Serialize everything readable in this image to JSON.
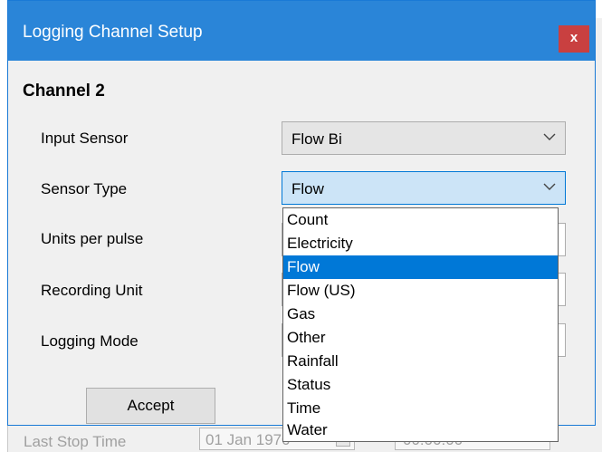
{
  "dialog": {
    "title": "Logging Channel Setup",
    "close_label": "x",
    "channel_title": "Channel 2",
    "accept_label": "Accept",
    "fields": {
      "input_sensor": {
        "label": "Input Sensor",
        "value": "Flow Bi"
      },
      "sensor_type": {
        "label": "Sensor Type",
        "value": "Flow"
      },
      "units_per_pulse": {
        "label": "Units per pulse"
      },
      "recording_unit": {
        "label": "Recording Unit"
      },
      "logging_mode": {
        "label": "Logging Mode"
      }
    }
  },
  "dropdown": {
    "items": [
      "Count",
      "Electricity",
      "Flow",
      "Flow (US)",
      "Gas",
      "Other",
      "Rainfall",
      "Status",
      "Time",
      "Water"
    ],
    "selected": "Flow"
  },
  "background": {
    "last_stop_label": "Last Stop Time",
    "date_value": "01 Jan 1970",
    "time_value": "00:00:00"
  },
  "colors": {
    "titlebar": "#2a85d8",
    "close_button": "#c94040",
    "selection": "#0078d7",
    "focused_combo": "#cce4f7"
  }
}
